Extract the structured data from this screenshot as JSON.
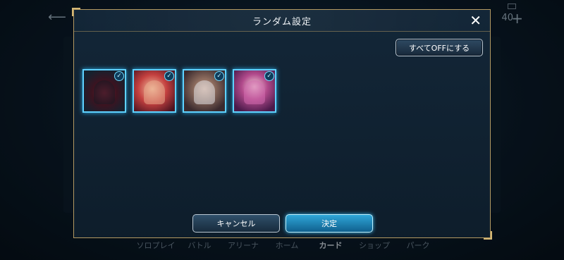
{
  "dialog": {
    "title": "ランダム設定",
    "close_glyph": "✕",
    "all_off_label": "すべてOFFにする",
    "cancel_label": "キャンセル",
    "ok_label": "決定"
  },
  "cards": [
    {
      "name": "dark-demon-card",
      "selected": true
    },
    {
      "name": "red-hair-girl-card",
      "selected": true
    },
    {
      "name": "silver-hair-girl-card",
      "selected": true
    },
    {
      "name": "purple-hair-girl-card",
      "selected": true
    }
  ],
  "check_glyph": "✓",
  "background": {
    "back_arrow": "⟵",
    "counter": "40",
    "plus": "+",
    "nav": [
      "ソロプレイ",
      "バトル",
      "アリーナ",
      "ホーム",
      "カード",
      "ショップ",
      "パーク"
    ],
    "active_nav": "カード"
  },
  "colors": {
    "accent_cyan": "#5fd2ff",
    "frame_gold": "#b49a62",
    "ok_blue": "#2fa6d8"
  }
}
